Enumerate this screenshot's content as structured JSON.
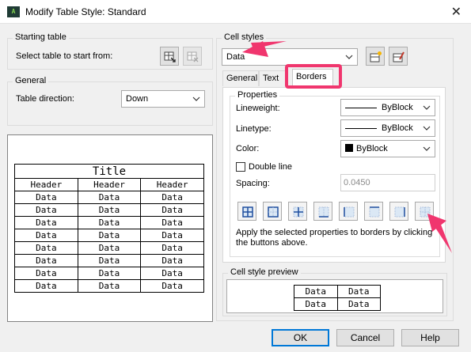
{
  "window": {
    "title": "Modify Table Style: Standard",
    "app_icon": "A",
    "close_icon": "close-icon"
  },
  "starting_table": {
    "group_label": "Starting table",
    "select_label": "Select table to start from:"
  },
  "general": {
    "group_label": "General",
    "direction_label": "Table direction:",
    "direction_value": "Down"
  },
  "preview_table": {
    "title": "Title",
    "headers": [
      "Header",
      "Header",
      "Header"
    ],
    "rows": [
      [
        "Data",
        "Data",
        "Data"
      ],
      [
        "Data",
        "Data",
        "Data"
      ],
      [
        "Data",
        "Data",
        "Data"
      ],
      [
        "Data",
        "Data",
        "Data"
      ],
      [
        "Data",
        "Data",
        "Data"
      ],
      [
        "Data",
        "Data",
        "Data"
      ],
      [
        "Data",
        "Data",
        "Data"
      ],
      [
        "Data",
        "Data",
        "Data"
      ]
    ]
  },
  "cell_styles": {
    "group_label": "Cell styles",
    "value": "Data",
    "tabs": [
      "General",
      "Text",
      "Borders"
    ],
    "active_tab": "Borders"
  },
  "properties": {
    "group_label": "Properties",
    "lineweight_label": "Lineweight:",
    "lineweight_value": "ByBlock",
    "linetype_label": "Linetype:",
    "linetype_value": "ByBlock",
    "color_label": "Color:",
    "color_value": "ByBlock",
    "double_line_label": "Double line",
    "double_line_checked": false,
    "spacing_label": "Spacing:",
    "spacing_value": "0.0450",
    "help_text": "Apply the selected properties to borders by clicking the buttons above."
  },
  "cell_style_preview": {
    "group_label": "Cell style preview",
    "rows": [
      [
        "Data",
        "Data"
      ],
      [
        "Data",
        "Data"
      ]
    ]
  },
  "buttons": {
    "ok": "OK",
    "cancel": "Cancel",
    "help": "Help"
  },
  "colors": {
    "highlight": "#f0366e",
    "default_button_border": "#0078d7"
  }
}
